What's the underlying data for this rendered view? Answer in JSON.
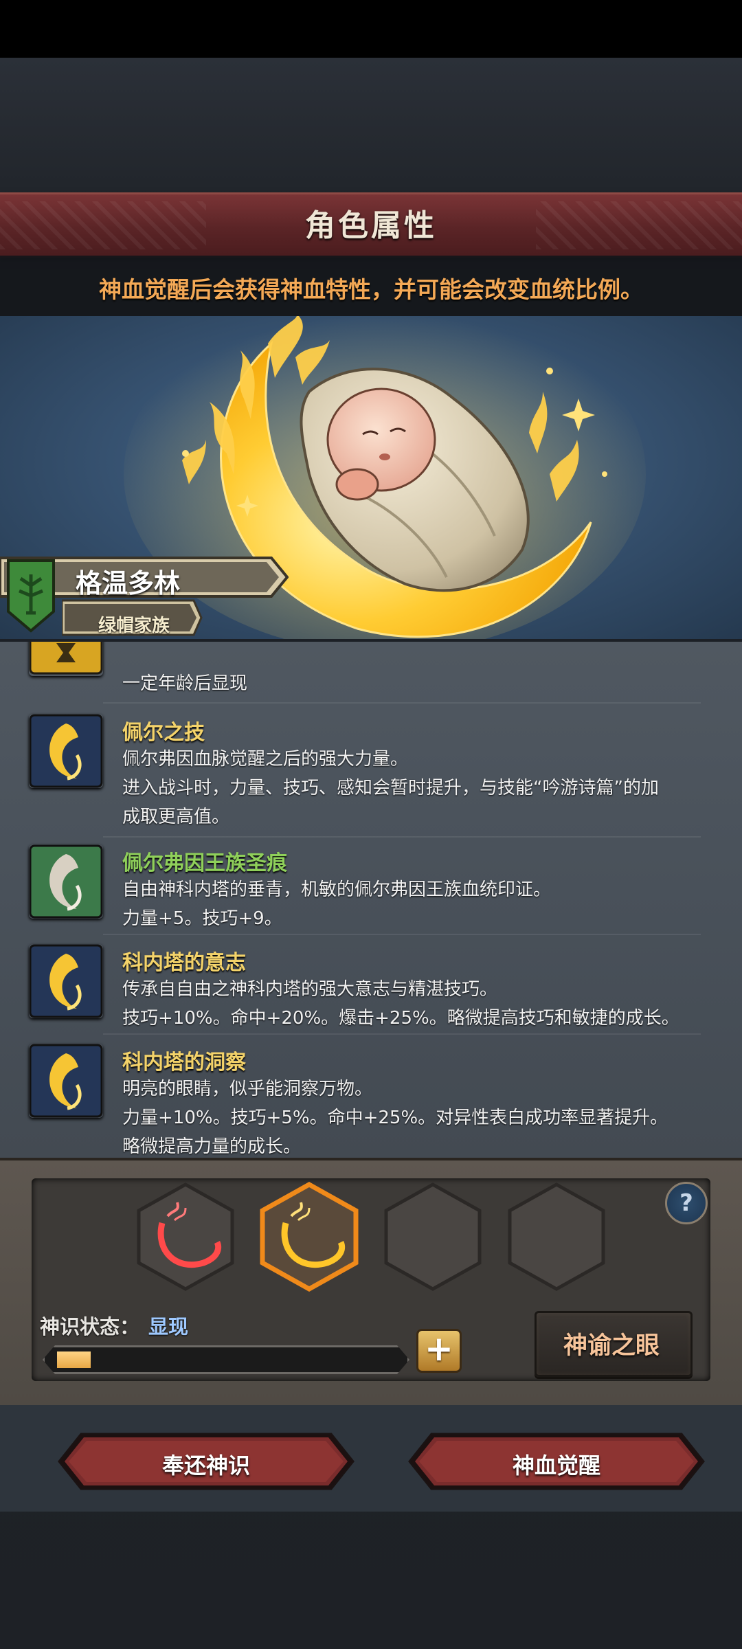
{
  "header": {
    "title": "角色属性",
    "subtitle": "神血觉醒后会获得神血特性，并可能会改变血统比例。"
  },
  "character": {
    "name": "格温多林",
    "house": "绿帽家族"
  },
  "traits": [
    {
      "name": "",
      "name_color": "#f4d36a",
      "icon": "locked-hourglass-icon",
      "lines": [
        "一定年龄后显现"
      ]
    },
    {
      "name": "佩尔之技",
      "name_color": "#f4d36a",
      "icon": "golden-crescent-icon",
      "lines": [
        "佩尔弗因血脉觉醒之后的强大力量。",
        "进入战斗时，力量、技巧、感知会暂时提升，与技能“吟游诗篇”的加",
        "成取更高值。"
      ]
    },
    {
      "name": "佩尔弗因王族圣痕",
      "name_color": "#8fd05a",
      "icon": "silver-crescent-icon",
      "lines": [
        "自由神科内塔的垂青，机敏的佩尔弗因王族血统印证。",
        "力量+5。技巧+9。"
      ]
    },
    {
      "name": "科内塔的意志",
      "name_color": "#f4d36a",
      "icon": "golden-crescent-icon",
      "lines": [
        "传承自自由之神科内塔的强大意志与精湛技巧。",
        "技巧+10%。命中+20%。爆击+25%。略微提高技巧和敏捷的成长。"
      ]
    },
    {
      "name": "科内塔的洞察",
      "name_color": "#f4d36a",
      "icon": "golden-crescent-icon",
      "lines": [
        "明亮的眼睛，似乎能洞察万物。",
        "力量+10%。技巧+5%。命中+25%。对异性表白成功率显著提升。",
        "略微提高力量的成长。"
      ]
    }
  ],
  "awakening": {
    "status_label": "神识状态：",
    "status_value": "显现",
    "progress": 0.1,
    "slots": [
      {
        "icon": "red-crescent-icon",
        "state": "filled"
      },
      {
        "icon": "gold-crescent-icon",
        "state": "selected"
      },
      {
        "icon": "",
        "state": "empty"
      },
      {
        "icon": "",
        "state": "empty"
      }
    ],
    "oracle_button": "神谕之眼",
    "help_icon": "question-icon",
    "help_glyph": "?",
    "plus_glyph": "+"
  },
  "actions": {
    "return_label": "奉还神识",
    "awaken_label": "神血觉醒"
  },
  "colors": {
    "accent_orange": "#f4a956",
    "trait_gold": "#f4d36a",
    "trait_green": "#8fd05a",
    "status_blue": "#9fc9ff"
  }
}
